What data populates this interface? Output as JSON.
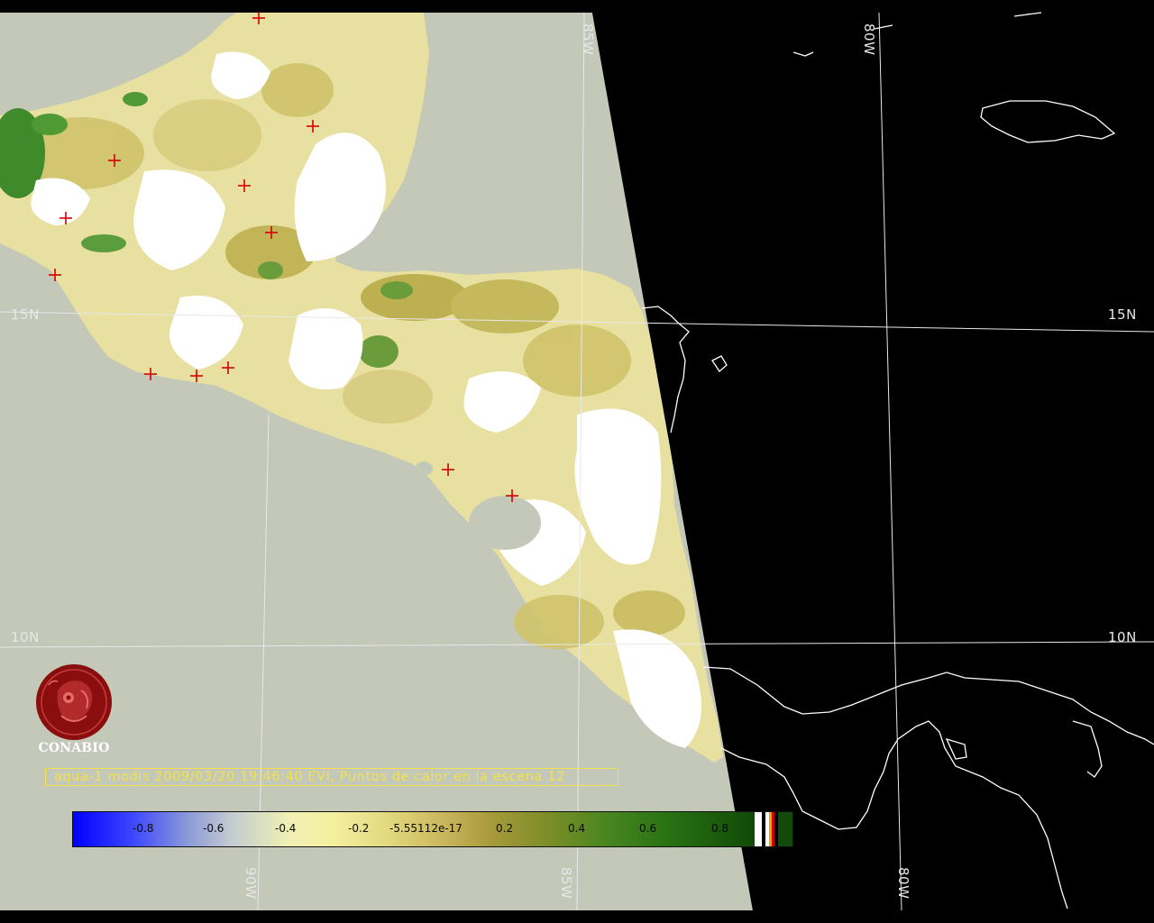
{
  "map": {
    "grid_labels": {
      "lat_15_left": "15N",
      "lat_15_right": "15N",
      "lat_10_left": "10N",
      "lat_10_right": "10N",
      "lon_85_top": "85W",
      "lon_80_top": "80W",
      "lon_90_bottom": "90W",
      "lon_85_bottom": "85W",
      "lon_80_bottom": "80W"
    },
    "colors": {
      "no_data_gray": "#c4c8b8",
      "night_black": "#000000",
      "cloud_white": "#ffffff",
      "coastline": "#ffffff",
      "gridline": "#e8e8e8",
      "hotspot_marker": "#d40000",
      "caption_yellow": "#f2e24a"
    },
    "hotspot_marker_icon": "red-cross-icon",
    "hotspot_count": 12
  },
  "logo": {
    "name": "CONABIO",
    "icon": "conabio-seal-icon",
    "color": "#8b0e0e"
  },
  "caption": {
    "text": "aqua-1 modis 2009/03/20 19:46:40 EVI, Puntos de calor en la escena 12"
  },
  "colorbar": {
    "ticks": [
      "-0.8",
      "-0.6",
      "-0.4",
      "-0.2",
      "-5.55112e-17",
      "0.2",
      "0.4",
      "0.6",
      "0.8"
    ],
    "colors": [
      "#0000ff",
      "#8c9ad8",
      "#f0f0b4",
      "#c8b45a",
      "#7c8e28",
      "#2a7414",
      "#114a0a"
    ],
    "special_colors": [
      "#ffffff",
      "#000000",
      "#ffffff",
      "#d7b000",
      "#d40000",
      "#000000"
    ]
  }
}
